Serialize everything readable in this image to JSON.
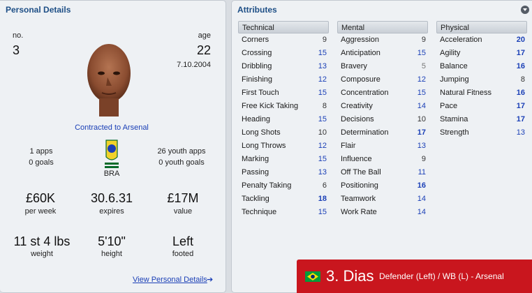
{
  "left": {
    "title": "Personal Details",
    "no_label": "no.",
    "no_value": "3",
    "age_label": "age",
    "age_value": "22",
    "dob": "7.10.2004",
    "contract": "Contracted to Arsenal",
    "apps": "1 apps",
    "goals": "0 goals",
    "youth_apps": "26 youth apps",
    "youth_goals": "0 youth goals",
    "nation_code": "BRA",
    "stats": [
      {
        "value": "£60K",
        "label": "per week"
      },
      {
        "value": "30.6.31",
        "label": "expires"
      },
      {
        "value": "£17M",
        "label": "value"
      },
      {
        "value": "11 st 4 lbs",
        "label": "weight"
      },
      {
        "value": "5'10\"",
        "label": "height"
      },
      {
        "value": "Left",
        "label": "footed"
      }
    ],
    "view_details": "View Personal Details"
  },
  "right": {
    "title": "Attributes",
    "columns": [
      {
        "header": "Technical",
        "rows": [
          {
            "name": "Corners",
            "value": "9"
          },
          {
            "name": "Crossing",
            "value": "15"
          },
          {
            "name": "Dribbling",
            "value": "13"
          },
          {
            "name": "Finishing",
            "value": "12"
          },
          {
            "name": "First Touch",
            "value": "15"
          },
          {
            "name": "Free Kick Taking",
            "value": "8"
          },
          {
            "name": "Heading",
            "value": "15"
          },
          {
            "name": "Long Shots",
            "value": "10"
          },
          {
            "name": "Long Throws",
            "value": "12"
          },
          {
            "name": "Marking",
            "value": "15"
          },
          {
            "name": "Passing",
            "value": "13"
          },
          {
            "name": "Penalty Taking",
            "value": "6"
          },
          {
            "name": "Tackling",
            "value": "18"
          },
          {
            "name": "Technique",
            "value": "15"
          }
        ]
      },
      {
        "header": "Mental",
        "rows": [
          {
            "name": "Aggression",
            "value": "9"
          },
          {
            "name": "Anticipation",
            "value": "15"
          },
          {
            "name": "Bravery",
            "value": "5"
          },
          {
            "name": "Composure",
            "value": "12"
          },
          {
            "name": "Concentration",
            "value": "15"
          },
          {
            "name": "Creativity",
            "value": "14"
          },
          {
            "name": "Decisions",
            "value": "10"
          },
          {
            "name": "Determination",
            "value": "17"
          },
          {
            "name": "Flair",
            "value": "13"
          },
          {
            "name": "Influence",
            "value": "9"
          },
          {
            "name": "Off The Ball",
            "value": "11"
          },
          {
            "name": "Positioning",
            "value": "16"
          },
          {
            "name": "Teamwork",
            "value": "14"
          },
          {
            "name": "Work Rate",
            "value": "14"
          }
        ]
      },
      {
        "header": "Physical",
        "rows": [
          {
            "name": "Acceleration",
            "value": "20"
          },
          {
            "name": "Agility",
            "value": "17"
          },
          {
            "name": "Balance",
            "value": "16"
          },
          {
            "name": "Jumping",
            "value": "8"
          },
          {
            "name": "Natural Fitness",
            "value": "16"
          },
          {
            "name": "Pace",
            "value": "17"
          },
          {
            "name": "Stamina",
            "value": "17"
          },
          {
            "name": "Strength",
            "value": "13"
          }
        ]
      }
    ]
  },
  "footer": {
    "player_name": "3. Dias",
    "player_info": "Defender (Left) / WB (L) - Arsenal",
    "bg_color": "#c9161e"
  }
}
